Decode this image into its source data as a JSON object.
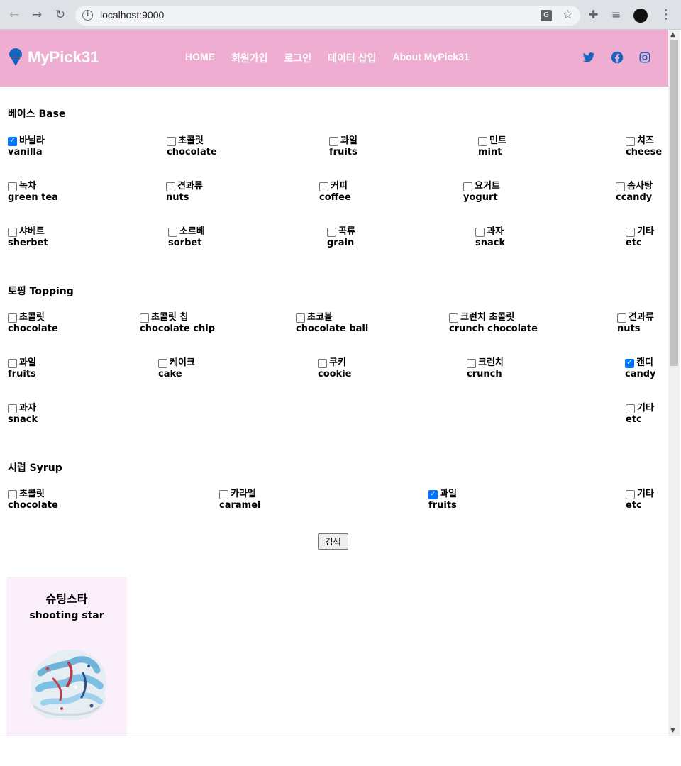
{
  "browser": {
    "url": "localhost:9000"
  },
  "header": {
    "logo": "MyPick31",
    "nav": [
      "HOME",
      "회원가입",
      "로그인",
      "데이터 삽입",
      "About MyPick31"
    ],
    "brand_color": "#efaed1",
    "social": [
      "twitter-icon",
      "facebook-icon",
      "instagram-icon"
    ]
  },
  "base": {
    "title": "베이스 Base",
    "options": [
      {
        "kr": "바닐라",
        "en": "vanilla",
        "checked": true
      },
      {
        "kr": "초콜릿",
        "en": "chocolate",
        "checked": false
      },
      {
        "kr": "과일",
        "en": "fruits",
        "checked": false
      },
      {
        "kr": "민트",
        "en": "mint",
        "checked": false
      },
      {
        "kr": "치즈",
        "en": "cheese",
        "checked": false
      },
      {
        "kr": "녹차",
        "en": "green tea",
        "checked": false
      },
      {
        "kr": "견과류",
        "en": "nuts",
        "checked": false
      },
      {
        "kr": "커피",
        "en": "coffee",
        "checked": false
      },
      {
        "kr": "요거트",
        "en": "yogurt",
        "checked": false
      },
      {
        "kr": "솜사탕",
        "en": "ccandy",
        "checked": false
      },
      {
        "kr": "샤베트",
        "en": "sherbet",
        "checked": false
      },
      {
        "kr": "소르베",
        "en": "sorbet",
        "checked": false
      },
      {
        "kr": "곡류",
        "en": "grain",
        "checked": false
      },
      {
        "kr": "과자",
        "en": "snack",
        "checked": false
      },
      {
        "kr": "기타",
        "en": "etc",
        "checked": false
      }
    ]
  },
  "topping": {
    "title": "토핑 Topping",
    "options": [
      {
        "kr": "초콜릿",
        "en": "chocolate",
        "checked": false
      },
      {
        "kr": "초콜릿 칩",
        "en": "chocolate chip",
        "checked": false
      },
      {
        "kr": "초코볼",
        "en": "chocolate ball",
        "checked": false
      },
      {
        "kr": "크런치 초콜릿",
        "en": "crunch chocolate",
        "checked": false
      },
      {
        "kr": "견과류",
        "en": "nuts",
        "checked": false
      },
      {
        "kr": "과일",
        "en": "fruits",
        "checked": false
      },
      {
        "kr": "케이크",
        "en": "cake",
        "checked": false
      },
      {
        "kr": "쿠키",
        "en": "cookie",
        "checked": false
      },
      {
        "kr": "크런치",
        "en": "crunch",
        "checked": false
      },
      {
        "kr": "캔디",
        "en": "candy",
        "checked": true
      },
      {
        "kr": "과자",
        "en": "snack",
        "checked": false
      },
      {
        "kr": "기타",
        "en": "etc",
        "checked": false
      }
    ]
  },
  "syrup": {
    "title": "시럽 Syrup",
    "options": [
      {
        "kr": "초콜릿",
        "en": "chocolate",
        "checked": false
      },
      {
        "kr": "카라멜",
        "en": "caramel",
        "checked": false
      },
      {
        "kr": "과일",
        "en": "fruits",
        "checked": true
      },
      {
        "kr": "기타",
        "en": "etc",
        "checked": false
      }
    ]
  },
  "search_label": "검색",
  "result": {
    "name_kr": "슈팅스타",
    "name_en": "shooting star"
  }
}
